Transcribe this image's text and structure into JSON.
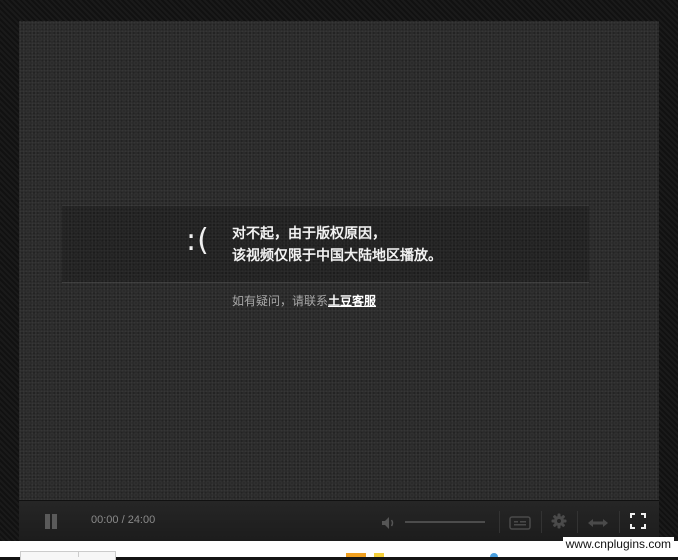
{
  "error": {
    "face": ":(",
    "line1": "对不起，由于版权原因，",
    "line2": "该视频仅限于中国大陆地区播放。",
    "help_prefix": "如有疑问，请联系",
    "help_link": "土豆客服"
  },
  "controls": {
    "time": "00:00 / 24:00"
  },
  "watermark": "www.cnplugins.com"
}
